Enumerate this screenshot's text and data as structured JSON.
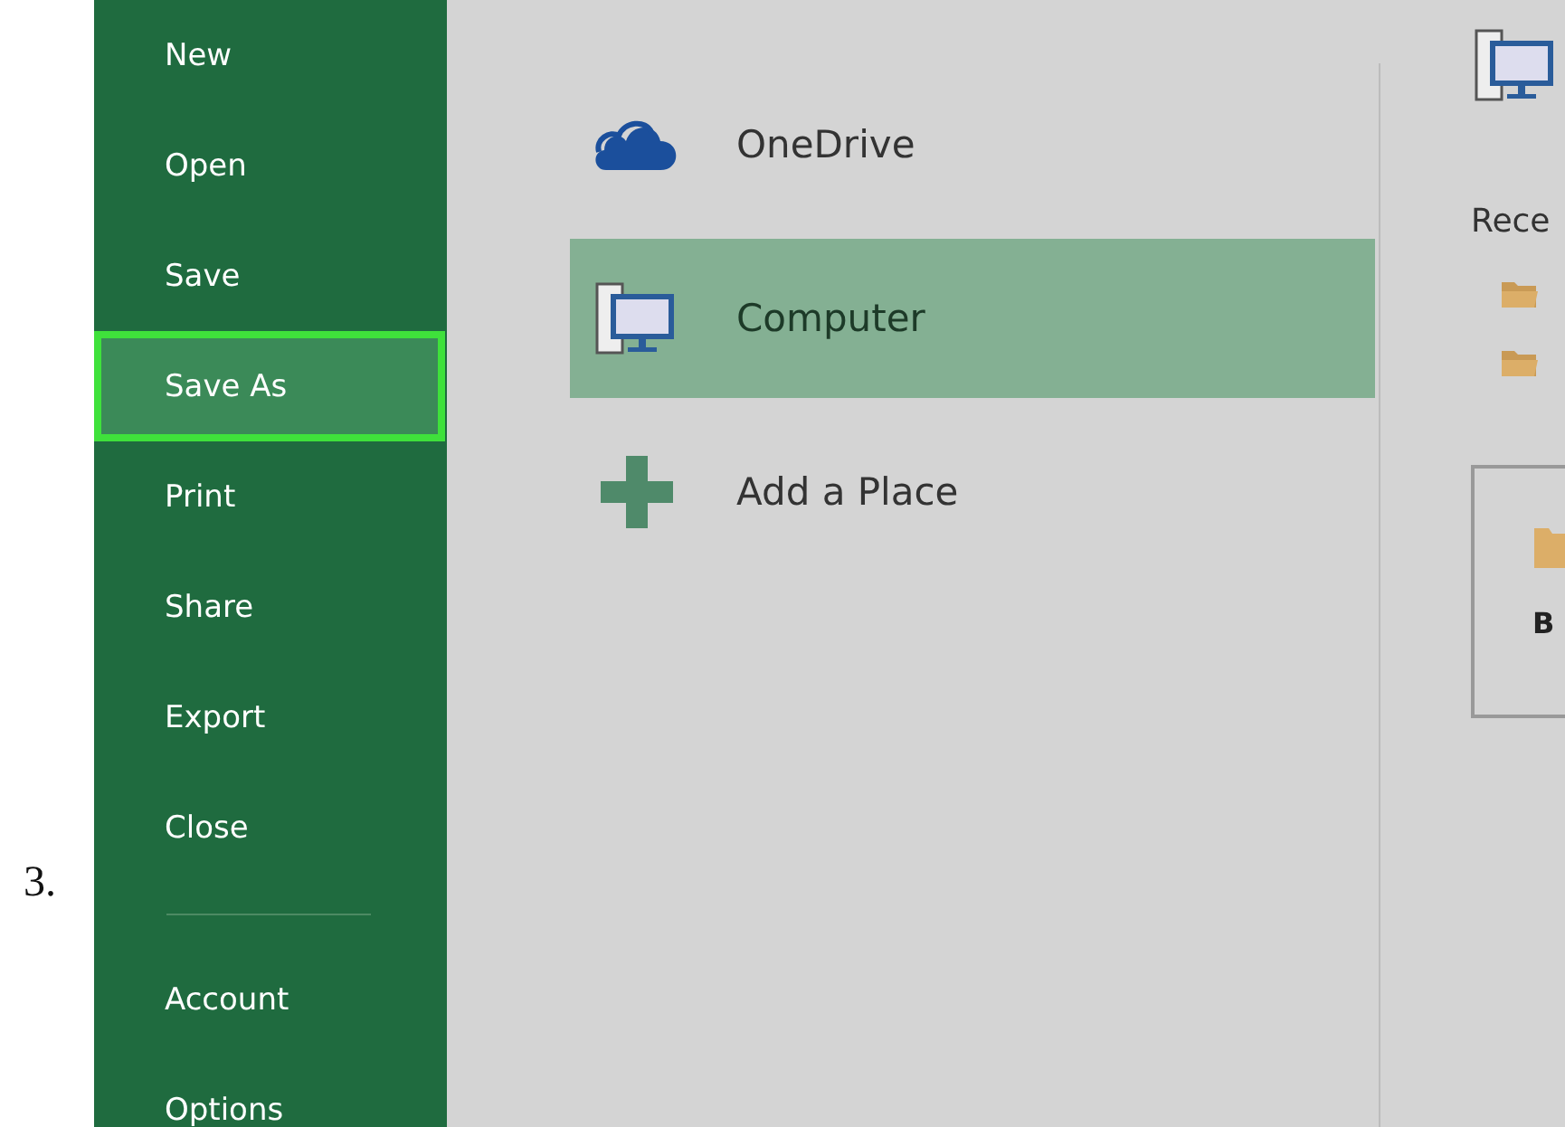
{
  "step_number": "3.",
  "sidebar": {
    "items": [
      {
        "label": "New",
        "selected": false
      },
      {
        "label": "Open",
        "selected": false
      },
      {
        "label": "Save",
        "selected": false
      },
      {
        "label": "Save As",
        "selected": true
      },
      {
        "label": "Print",
        "selected": false
      },
      {
        "label": "Share",
        "selected": false
      },
      {
        "label": "Export",
        "selected": false
      },
      {
        "label": "Close",
        "selected": false
      }
    ],
    "bottom_items": [
      {
        "label": "Account",
        "selected": false
      },
      {
        "label": "Options",
        "selected": false
      }
    ]
  },
  "places": [
    {
      "kind": "onedrive",
      "label": "OneDrive",
      "selected": false
    },
    {
      "kind": "computer",
      "label": "Computer",
      "selected": true
    },
    {
      "kind": "add",
      "label": "Add a Place",
      "selected": false
    }
  ],
  "right_panel": {
    "recent_heading": "Rece",
    "recent_folders": [
      {
        "kind": "folder"
      },
      {
        "kind": "folder"
      }
    ],
    "browse_button": "B"
  }
}
